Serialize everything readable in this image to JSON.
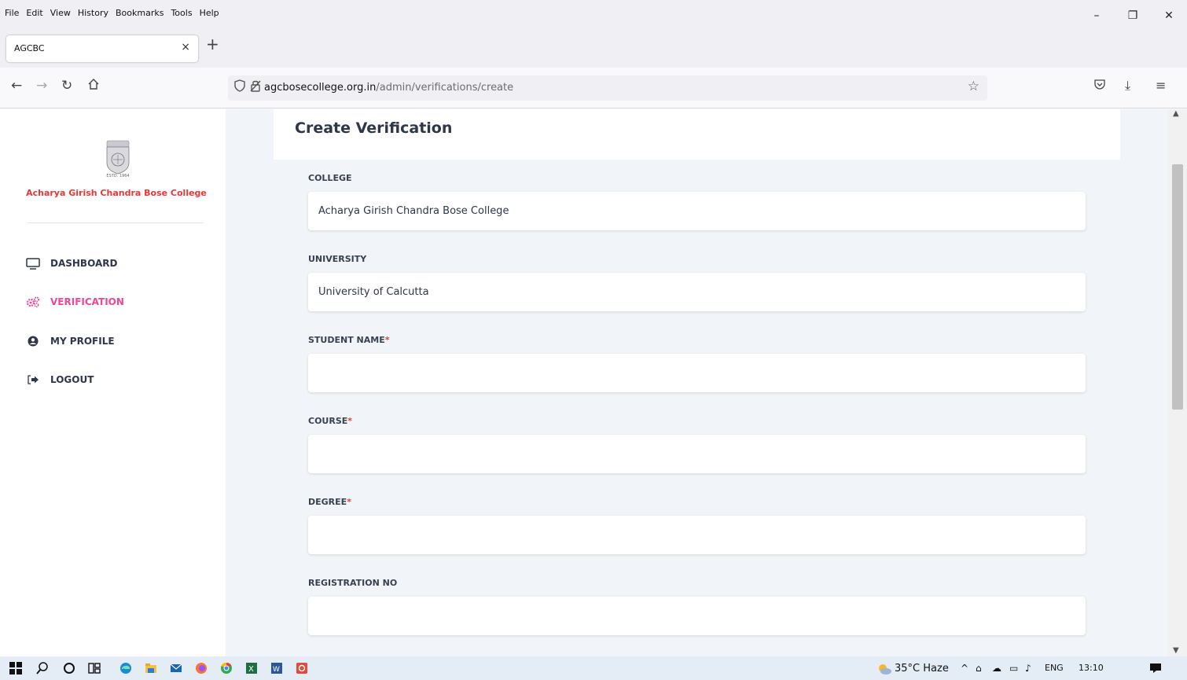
{
  "menu": {
    "items": [
      "File",
      "Edit",
      "View",
      "History",
      "Bookmarks",
      "Tools",
      "Help"
    ]
  },
  "tab": {
    "title": "AGCBC",
    "close": "×",
    "new_tab": "+"
  },
  "window_controls": {
    "minimize": "–",
    "restore": "❐",
    "close": "✕"
  },
  "url": {
    "host": "agcbosecollege.org.in",
    "path": "/admin/verifications/create"
  },
  "sidebar": {
    "college_name": "Acharya Girish Chandra Bose College",
    "logo_text": "ESTD. 1964",
    "items": [
      {
        "label": "DASHBOARD",
        "icon": "monitor-icon",
        "active": false
      },
      {
        "label": "VERIFICATION",
        "icon": "cogs-icon",
        "active": true
      },
      {
        "label": "MY PROFILE",
        "icon": "user-circle-icon",
        "active": false
      },
      {
        "label": "LOGOUT",
        "icon": "sign-out-icon",
        "active": false
      }
    ]
  },
  "form": {
    "title": "Create Verification",
    "fields": [
      {
        "label": "COLLEGE",
        "required": false,
        "value": "Acharya Girish Chandra Bose College"
      },
      {
        "label": "UNIVERSITY",
        "required": false,
        "value": "University of Calcutta"
      },
      {
        "label": "STUDENT NAME",
        "required": true,
        "value": ""
      },
      {
        "label": "COURSE",
        "required": true,
        "value": ""
      },
      {
        "label": "DEGREE",
        "required": true,
        "value": ""
      },
      {
        "label": "REGISTRATION NO",
        "required": false,
        "value": ""
      }
    ],
    "required_mark": "*"
  },
  "taskbar": {
    "weather": "35°C Haze",
    "language": "ENG",
    "time": "13:10"
  },
  "colors": {
    "accent": "#ec4899",
    "college_name": "#e63838",
    "required": "#e53e3e"
  }
}
